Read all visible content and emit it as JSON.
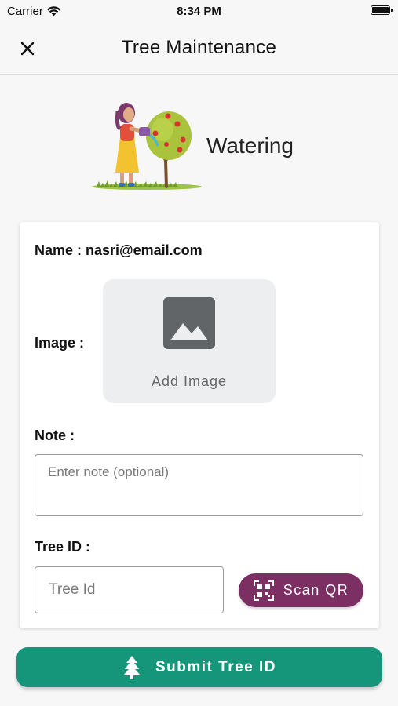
{
  "status_bar": {
    "carrier": "Carrier",
    "time": "8:34 PM"
  },
  "app_bar": {
    "title": "Tree Maintenance"
  },
  "hero": {
    "label": "Watering"
  },
  "form": {
    "name_label": "Name : nasri@email.com",
    "image_label": "Image :",
    "add_image_label": "Add Image",
    "note_label": "Note :",
    "note_placeholder": "Enter note (optional)",
    "tree_id_label": "Tree ID :",
    "tree_id_placeholder": "Tree Id",
    "scan_qr_label": "Scan QR"
  },
  "submit": {
    "label": "Submit Tree ID"
  },
  "colors": {
    "scan_button": "#7c2f63",
    "submit_button": "#15967a",
    "background": "#f7f7f7"
  }
}
